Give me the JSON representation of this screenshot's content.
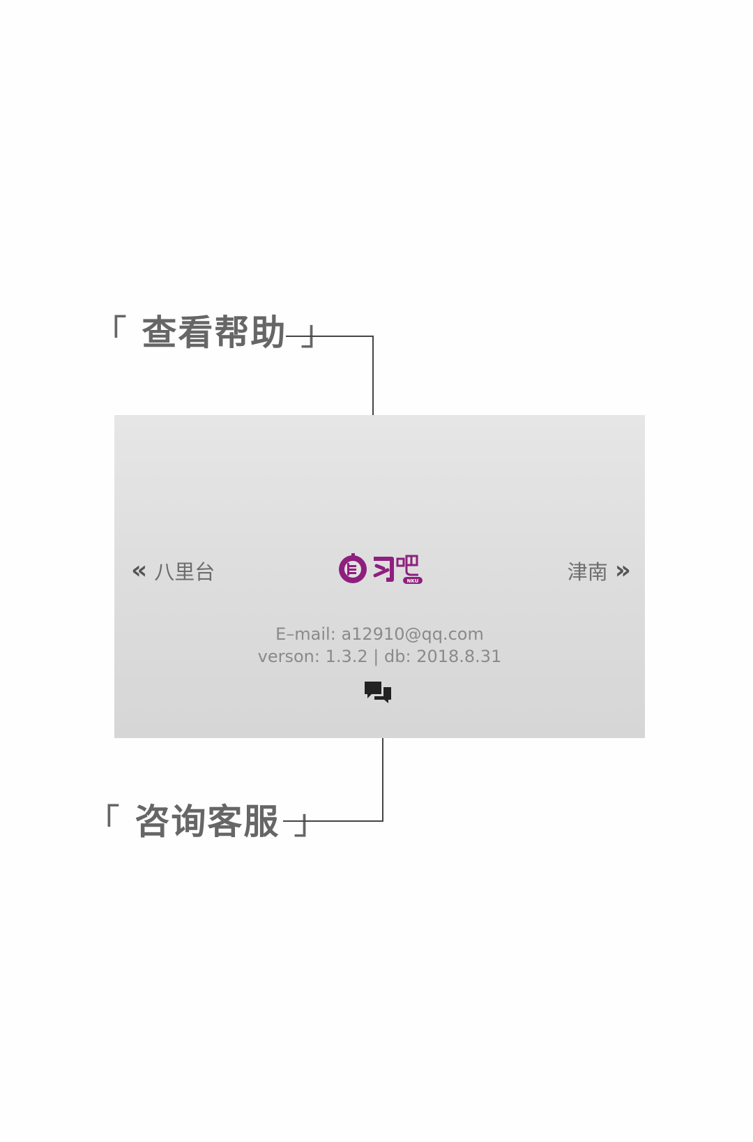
{
  "callouts": {
    "help": {
      "open": "「",
      "text": "查看帮助",
      "close": "」"
    },
    "service": {
      "open": "「",
      "text": "咨询客服",
      "close": "」"
    }
  },
  "panel": {
    "prev": {
      "label": "八里台",
      "icon": "double-chevron-left-icon"
    },
    "next": {
      "label": "津南",
      "icon": "double-chevron-right-icon"
    },
    "logo": {
      "icon": "zixiba-logo",
      "brand_color": "#8e1f7e",
      "wordmark": "自习吧",
      "tag": "NKU"
    },
    "email_line": "E–mail: a12910@qq.com",
    "version_line": "verson: 1.3.2 | db: 2018.8.31",
    "chat_icon": "chat-bubbles-icon"
  }
}
